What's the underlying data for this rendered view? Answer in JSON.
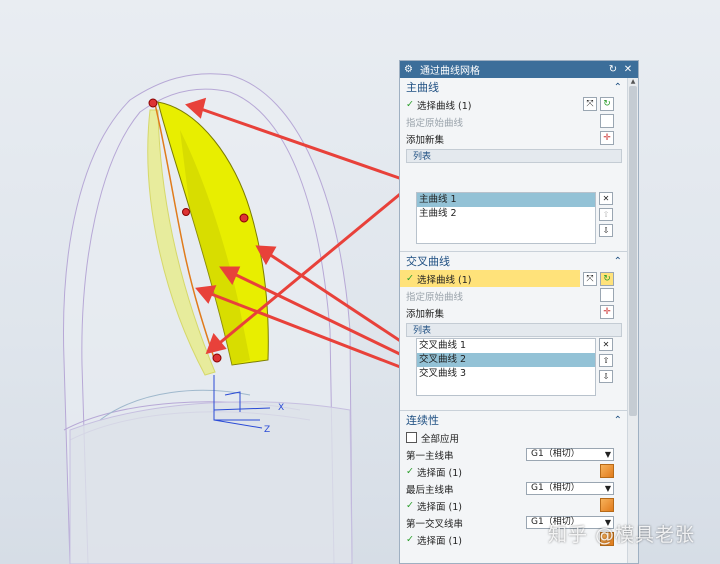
{
  "dialog": {
    "title": "通过曲线网格",
    "primary": {
      "header": "主曲线",
      "select_curve": "选择曲线 (1)",
      "specify_origin": "指定原始曲线",
      "add_new_set": "添加新集",
      "list_header": "列表",
      "items": [
        "主曲线 1",
        "主曲线 2"
      ]
    },
    "cross": {
      "header": "交叉曲线",
      "select_curve": "选择曲线 (1)",
      "specify_origin": "指定原始曲线",
      "add_new_set": "添加新集",
      "list_header": "列表",
      "items": [
        "交叉曲线 1",
        "交叉曲线 2",
        "交叉曲线 3"
      ]
    },
    "continuity": {
      "header": "连续性",
      "apply_all": "全部应用",
      "first_primary": "第一主线串",
      "first_primary_value": "G1（相切）",
      "select_face_1": "选择面 (1)",
      "last_primary": "最后主线串",
      "last_primary_value": "G1（相切）",
      "select_face_2": "选择面 (1)",
      "first_cross": "第一交叉线串",
      "first_cross_value": "G1（相切）",
      "select_face_3": "选择面 (1)"
    }
  },
  "axes": {
    "x": "X",
    "z": "Z"
  },
  "watermark": "知乎 @模具老张",
  "colors": {
    "titlebar": "#3c6e9a",
    "highlight": "#ffe27a",
    "list_highlight": "#93c2d6",
    "surface": "#e8ee00",
    "arrow": "#e8413a"
  }
}
